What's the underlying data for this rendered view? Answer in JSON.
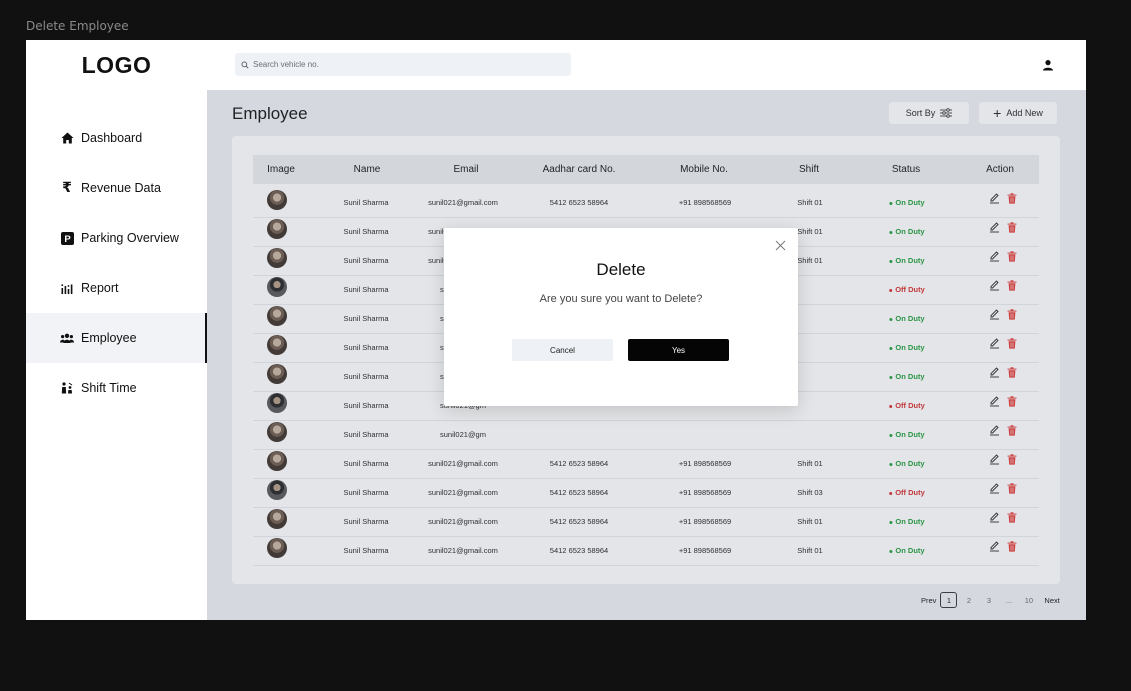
{
  "frame_label": "Delete Employee",
  "app": {
    "logo": "LOGO"
  },
  "search": {
    "placeholder": "Search vehicle no."
  },
  "sidebar": {
    "items": [
      {
        "label": "Dashboard",
        "icon": "home-icon"
      },
      {
        "label": "Revenue Data",
        "icon": "rupee-icon"
      },
      {
        "label": "Parking Overview",
        "icon": "parking-icon"
      },
      {
        "label": "Report",
        "icon": "report-icon"
      },
      {
        "label": "Employee",
        "icon": "users-icon",
        "active": true
      },
      {
        "label": "Shift Time",
        "icon": "shift-time-icon"
      }
    ]
  },
  "main": {
    "title": "Employee",
    "sort_label": "Sort By",
    "add_label": "Add New"
  },
  "table": {
    "headers": [
      "Image",
      "Name",
      "Email",
      "Aadhar card No.",
      "Mobile No.",
      "Shift",
      "Status",
      "Action"
    ],
    "rows": [
      {
        "name": "Sunil Sharma",
        "email": "sunil021@gmail.com",
        "aadhar": "5412 6523 58964",
        "mobile": "+91 898568569",
        "shift": "Shift 01",
        "status": "On Duty"
      },
      {
        "name": "Sunil Sharma",
        "email": "sunil021@gmail.com",
        "aadhar": "5412 6523 58964",
        "mobile": "+91 898568569",
        "shift": "Shift 01",
        "status": "On Duty"
      },
      {
        "name": "Sunil Sharma",
        "email": "sunil021@gmail.com",
        "aadhar": "5412 6523 58964",
        "mobile": "+91 898568569",
        "shift": "Shift 01",
        "status": "On Duty"
      },
      {
        "name": "Sunil Sharma",
        "email": "sunil021@gm",
        "aadhar": "",
        "mobile": "",
        "shift": "",
        "status": "Off Duty"
      },
      {
        "name": "Sunil Sharma",
        "email": "sunil021@gm",
        "aadhar": "",
        "mobile": "",
        "shift": "",
        "status": "On Duty"
      },
      {
        "name": "Sunil Sharma",
        "email": "sunil021@gm",
        "aadhar": "",
        "mobile": "",
        "shift": "",
        "status": "On Duty"
      },
      {
        "name": "Sunil Sharma",
        "email": "sunil021@gm",
        "aadhar": "",
        "mobile": "",
        "shift": "",
        "status": "On Duty"
      },
      {
        "name": "Sunil Sharma",
        "email": "sunil021@gm",
        "aadhar": "",
        "mobile": "",
        "shift": "",
        "status": "Off Duty"
      },
      {
        "name": "Sunil Sharma",
        "email": "sunil021@gm",
        "aadhar": "",
        "mobile": "",
        "shift": "",
        "status": "On Duty"
      },
      {
        "name": "Sunil Sharma",
        "email": "sunil021@gmail.com",
        "aadhar": "5412 6523 58964",
        "mobile": "+91 898568569",
        "shift": "Shift 01",
        "status": "On Duty"
      },
      {
        "name": "Sunil Sharma",
        "email": "sunil021@gmail.com",
        "aadhar": "5412 6523 58964",
        "mobile": "+91 898568569",
        "shift": "Shift 03",
        "status": "Off Duty"
      },
      {
        "name": "Sunil Sharma",
        "email": "sunil021@gmail.com",
        "aadhar": "5412 6523 58964",
        "mobile": "+91 898568569",
        "shift": "Shift 01",
        "status": "On Duty"
      },
      {
        "name": "Sunil Sharma",
        "email": "sunil021@gmail.com",
        "aadhar": "5412 6523 58964",
        "mobile": "+91 898568569",
        "shift": "Shift 01",
        "status": "On Duty"
      }
    ]
  },
  "pagination": {
    "prev": "Prev",
    "pages": [
      "1",
      "2",
      "3",
      "...",
      "10"
    ],
    "current": "1",
    "next": "Next"
  },
  "modal": {
    "title": "Delete",
    "message": "Are you sure you want to Delete?",
    "cancel_label": "Cancel",
    "confirm_label": "Yes"
  },
  "colors": {
    "on_duty": "#1f9d3a",
    "off_duty": "#d62c2c",
    "delete_icon": "#e53935",
    "primary_button": "#050505"
  }
}
